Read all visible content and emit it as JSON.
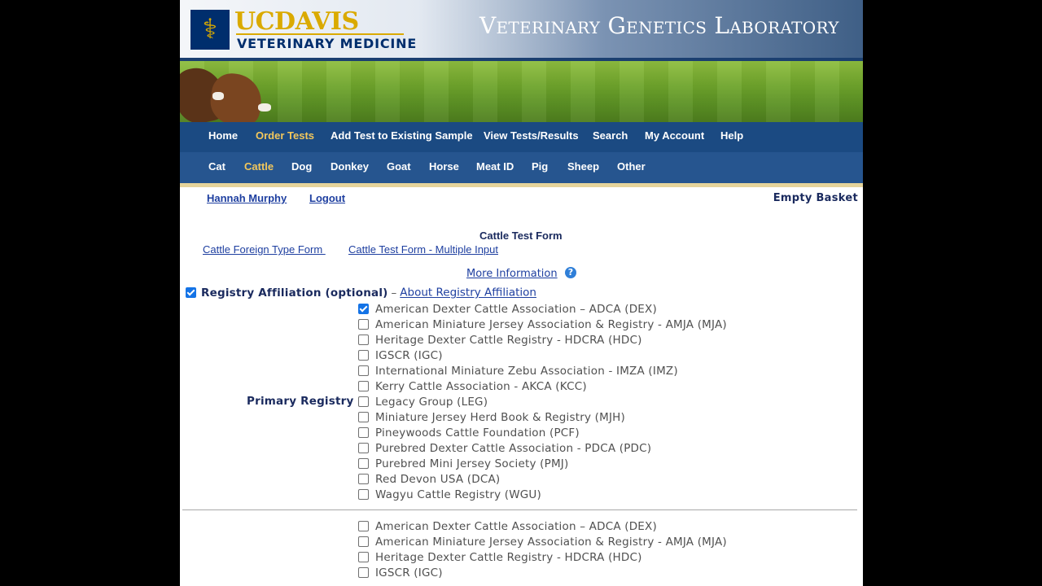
{
  "header": {
    "uc_prefix": "UC",
    "uc_name": "DAVIS",
    "school": "VETERINARY MEDICINE",
    "lab_title": "Veterinary Genetics Laboratory"
  },
  "nav_primary": [
    {
      "label": "Home",
      "active": false
    },
    {
      "label": "Order Tests",
      "active": true
    },
    {
      "label": "Add Test to Existing Sample",
      "active": false
    },
    {
      "label": "View Tests/Results",
      "active": false
    },
    {
      "label": "Search",
      "active": false
    },
    {
      "label": "My Account",
      "active": false
    },
    {
      "label": "Help",
      "active": false
    }
  ],
  "nav_species": [
    {
      "label": "Cat",
      "active": false
    },
    {
      "label": "Cattle",
      "active": true
    },
    {
      "label": "Dog",
      "active": false
    },
    {
      "label": "Donkey",
      "active": false
    },
    {
      "label": "Goat",
      "active": false
    },
    {
      "label": "Horse",
      "active": false
    },
    {
      "label": "Meat ID",
      "active": false
    },
    {
      "label": "Pig",
      "active": false
    },
    {
      "label": "Sheep",
      "active": false
    },
    {
      "label": "Other",
      "active": false
    }
  ],
  "user": {
    "name": "Hannah Murphy",
    "logout": "Logout",
    "basket": "Empty Basket"
  },
  "form": {
    "title": "Cattle Test Form",
    "link_foreign": "Cattle Foreign Type Form ",
    "link_multiple": "Cattle Test Form - Multiple Input",
    "more_info": "More Information ",
    "help_icon": "?"
  },
  "affiliation": {
    "label": "Registry Affiliation (optional)",
    "separator": "–",
    "about_link": "About Registry Affiliation",
    "checked": true
  },
  "primary_registry": {
    "label": "Primary Registry",
    "options": [
      {
        "label": "American Dexter Cattle Association – ADCA (DEX)",
        "checked": true
      },
      {
        "label": "American Miniature Jersey Association & Registry - AMJA (MJA)",
        "checked": false
      },
      {
        "label": "Heritage Dexter Cattle Registry - HDCRA (HDC)",
        "checked": false
      },
      {
        "label": "IGSCR (IGC)",
        "checked": false
      },
      {
        "label": "International Miniature Zebu Association - IMZA (IMZ)",
        "checked": false
      },
      {
        "label": "Kerry Cattle Association - AKCA (KCC)",
        "checked": false
      },
      {
        "label": "Legacy Group (LEG)",
        "checked": false
      },
      {
        "label": "Miniature Jersey Herd Book & Registry (MJH)",
        "checked": false
      },
      {
        "label": "Pineywoods Cattle Foundation (PCF)",
        "checked": false
      },
      {
        "label": "Purebred Dexter Cattle Association - PDCA (PDC)",
        "checked": false
      },
      {
        "label": "Purebred Mini Jersey Society (PMJ)",
        "checked": false
      },
      {
        "label": "Red Devon USA (DCA)",
        "checked": false
      },
      {
        "label": "Wagyu Cattle Registry (WGU)",
        "checked": false
      }
    ]
  },
  "secondary_registry": {
    "options": [
      {
        "label": "American Dexter Cattle Association – ADCA (DEX)",
        "checked": false
      },
      {
        "label": "American Miniature Jersey Association & Registry - AMJA (MJA)",
        "checked": false
      },
      {
        "label": "Heritage Dexter Cattle Registry - HDCRA (HDC)",
        "checked": false
      },
      {
        "label": "IGSCR (IGC)",
        "checked": false
      }
    ]
  },
  "colors": {
    "nav_bg": "#1b4a82",
    "nav_active": "#f2c75c",
    "brand_gold": "#daaa00",
    "brand_navy": "#002e6d",
    "link": "#1e3fa0"
  }
}
